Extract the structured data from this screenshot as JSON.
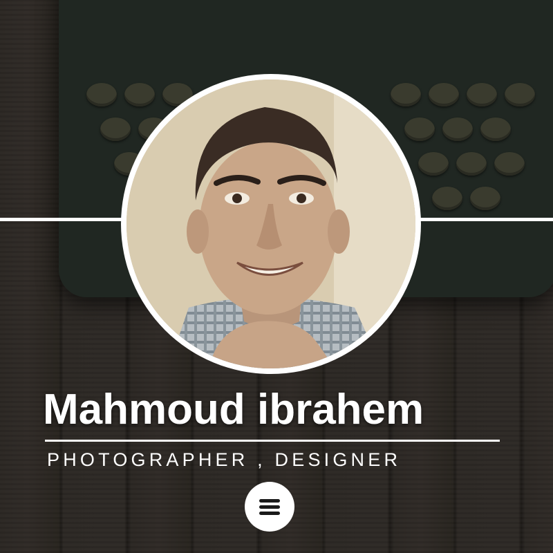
{
  "profile": {
    "name": "Mahmoud ibrahem",
    "subtitle": "PHOTOGRAPHER , DESIGNER"
  },
  "menu": {
    "icon": "hamburger-menu-icon"
  },
  "colors": {
    "text": "#ffffff",
    "background": "#2a2622",
    "accent": "#ffffff"
  }
}
